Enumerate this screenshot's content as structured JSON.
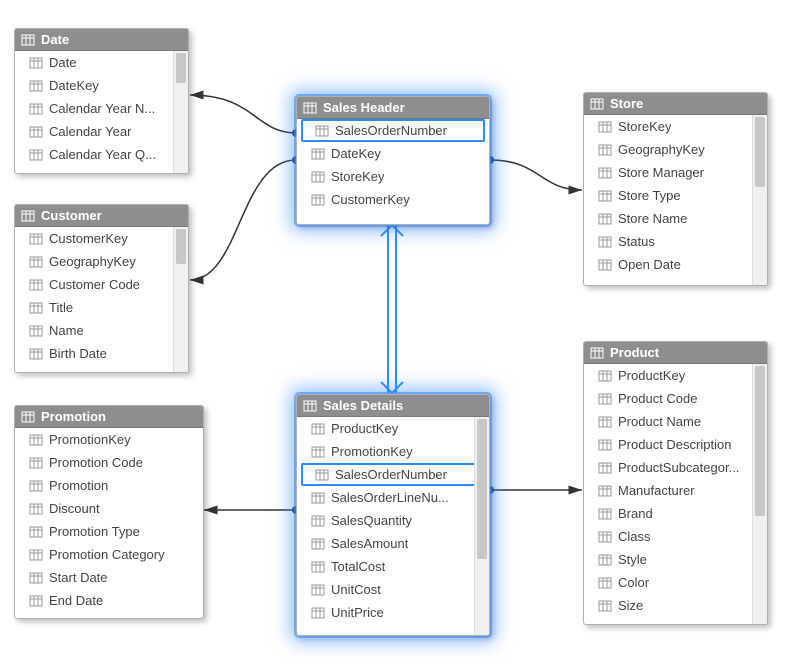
{
  "tables": {
    "date": {
      "title": "Date",
      "columns": [
        "Date",
        "DateKey",
        "Calendar Year N...",
        "Calendar Year",
        "Calendar Year Q..."
      ]
    },
    "customer": {
      "title": "Customer",
      "columns": [
        "CustomerKey",
        "GeographyKey",
        "Customer Code",
        "Title",
        "Name",
        "Birth Date"
      ]
    },
    "promotion": {
      "title": "Promotion",
      "columns": [
        "PromotionKey",
        "Promotion Code",
        "Promotion",
        "Discount",
        "Promotion Type",
        "Promotion Category",
        "Start Date",
        "End Date"
      ]
    },
    "salesHeader": {
      "title": "Sales Header",
      "columns": [
        "SalesOrderNumber",
        "DateKey",
        "StoreKey",
        "CustomerKey"
      ]
    },
    "salesDetails": {
      "title": "Sales Details",
      "columns": [
        "ProductKey",
        "PromotionKey",
        "SalesOrderNumber",
        "SalesOrderLineNu...",
        "SalesQuantity",
        "SalesAmount",
        "TotalCost",
        "UnitCost",
        "UnitPrice"
      ]
    },
    "store": {
      "title": "Store",
      "columns": [
        "StoreKey",
        "GeographyKey",
        "Store Manager",
        "Store Type",
        "Store Name",
        "Status",
        "Open Date"
      ]
    },
    "product": {
      "title": "Product",
      "columns": [
        "ProductKey",
        "Product Code",
        "Product Name",
        "Product Description",
        "ProductSubcategor...",
        "Manufacturer",
        "Brand",
        "Class",
        "Style",
        "Color",
        "Size"
      ]
    }
  }
}
